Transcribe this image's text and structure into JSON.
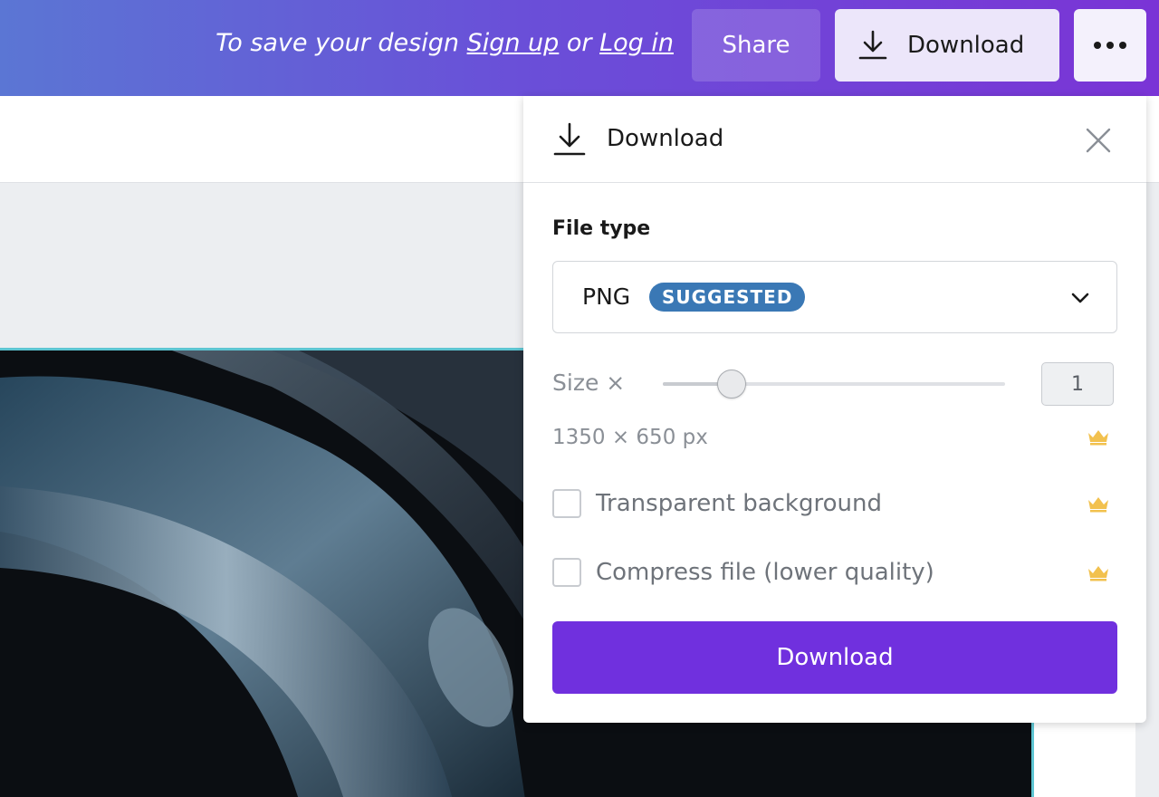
{
  "topbar": {
    "save_prefix": "To save your design ",
    "sign_up": "Sign up",
    "or": " or ",
    "log_in": "Log in",
    "share_label": "Share",
    "download_label": "Download",
    "more_icon": "more-horizontal-icon"
  },
  "panel": {
    "title": "Download",
    "close_icon": "close-icon",
    "file_type_label": "File type",
    "file_type_value": "PNG",
    "file_type_badge": "SUGGESTED",
    "size_label": "Size ×",
    "size_value": "1",
    "size_slider_fraction": 0.2,
    "dimensions": "1350 × 650 px",
    "options": [
      {
        "label": "Transparent background",
        "checked": false,
        "premium": true
      },
      {
        "label": "Compress file (lower quality)",
        "checked": false,
        "premium": true
      }
    ],
    "download_button": "Download"
  },
  "colors": {
    "accent": "#7030de",
    "badge": "#3a78b5",
    "crown": "#f2c14e",
    "canvas_border": "#5ec5d2"
  }
}
